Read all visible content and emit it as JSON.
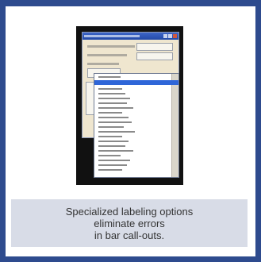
{
  "caption": {
    "line1": "Specialized labeling options",
    "line2": "eliminate errors",
    "line3": "in bar call-outs."
  },
  "colors": {
    "border": "#2e4b8e",
    "caption_background": "#d8dce7",
    "selection": "#2f66d8"
  },
  "icons": [
    "close-icon",
    "minimize-icon",
    "maximize-icon"
  ]
}
